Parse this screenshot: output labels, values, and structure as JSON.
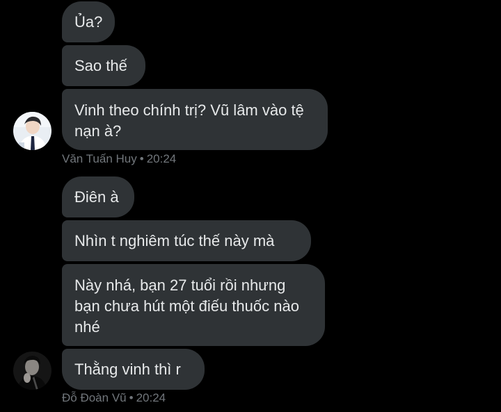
{
  "group1": {
    "messages": [
      {
        "text": "Ủa?"
      },
      {
        "text": "Sao thế"
      },
      {
        "text": "Vinh theo chính trị? Vũ lâm vào tệ nạn à?"
      }
    ],
    "sender": "Văn Tuấn Huy",
    "separator": "•",
    "time": "20:24"
  },
  "group2": {
    "messages": [
      {
        "text": "Điên à"
      },
      {
        "text": "Nhìn t nghiêm túc thế này mà"
      },
      {
        "text": "Này nhá, bạn 27 tuổi rồi nhưng bạn chưa hút một điếu thuốc nào nhé"
      },
      {
        "text": "Thằng vinh thì r"
      }
    ],
    "sender": "Đỗ Đoàn Vũ",
    "separator": "•",
    "time": "20:24"
  },
  "colors": {
    "background": "#000000",
    "bubble": "#2f3336",
    "text": "#e7e9ea",
    "meta": "#71767b"
  }
}
